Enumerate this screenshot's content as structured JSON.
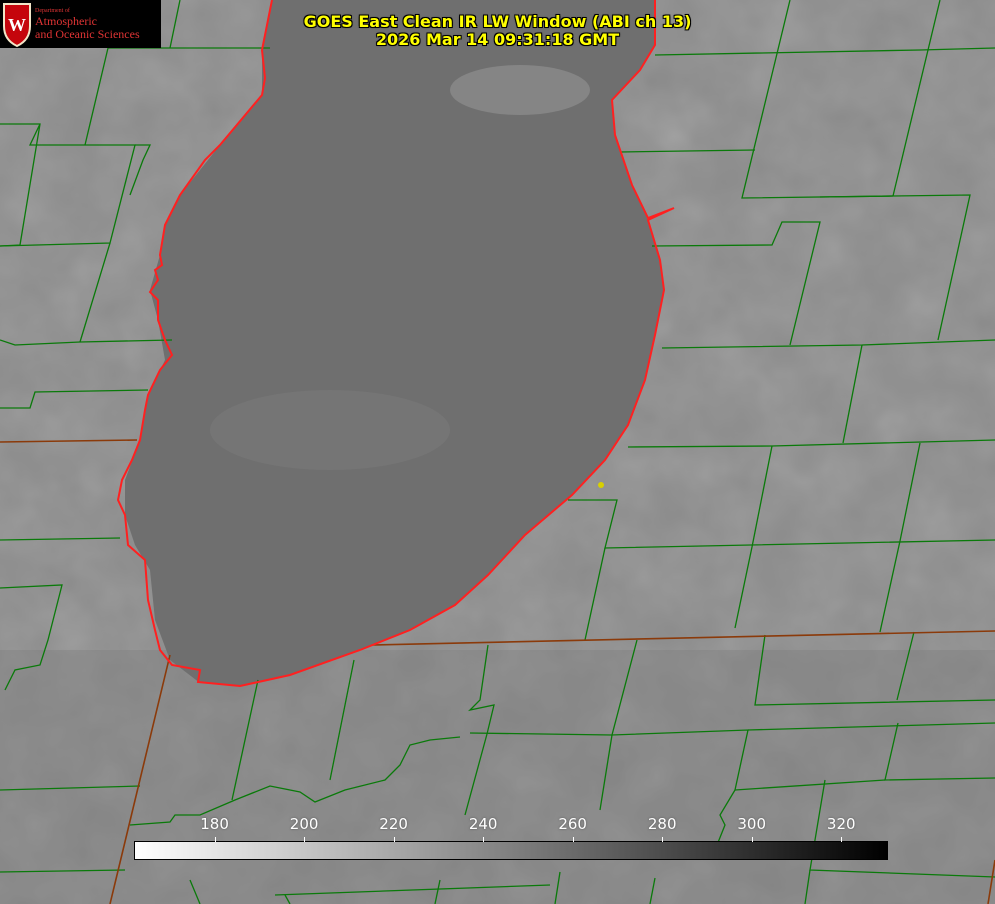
{
  "title": {
    "line1": "GOES East Clean IR LW Window (ABI ch 13)",
    "line2": "2026 Mar 14 09:31:18 GMT"
  },
  "logo": {
    "name": "uw-madison-crest",
    "line_dept": "Department of",
    "line1": "Atmospheric",
    "line2": "and Oceanic Sciences",
    "accent": "#c5050c"
  },
  "colorbar": {
    "min": 162,
    "max": 330,
    "ticks": [
      180,
      200,
      220,
      240,
      260,
      280,
      300,
      320
    ],
    "colors": {
      "low": "#ffffff",
      "high": "#000000"
    }
  },
  "colors": {
    "county_lines": "#0a7a0a",
    "state_lines": "#8b3a0a",
    "shoreline": "#ff2020",
    "marker": "#d8d000",
    "title_text": "#ffff00"
  }
}
